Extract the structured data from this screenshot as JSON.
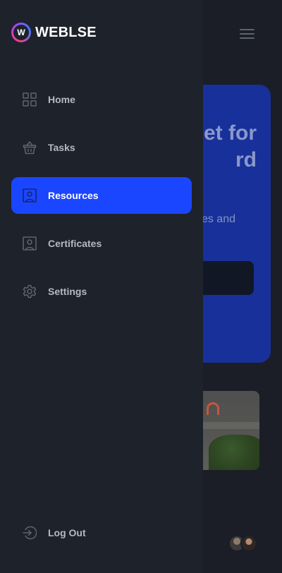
{
  "brand": {
    "logo_letter": "W",
    "name": "WEBLSE"
  },
  "background": {
    "hero_title": "et for\nrd",
    "hero_subtitle": "es and"
  },
  "nav": {
    "items": [
      {
        "label": "Home",
        "icon": "grid-icon",
        "active": false
      },
      {
        "label": "Tasks",
        "icon": "basket-icon",
        "active": false
      },
      {
        "label": "Resources",
        "icon": "portrait-icon",
        "active": true
      },
      {
        "label": "Certificates",
        "icon": "portrait-icon",
        "active": false
      },
      {
        "label": "Settings",
        "icon": "gear-icon",
        "active": false
      }
    ],
    "logout_label": "Log Out"
  },
  "colors": {
    "accent": "#1b46ff",
    "drawer_bg": "#1e222b",
    "nav_text": "#b4b9c3",
    "icon_stroke": "#5e6573"
  }
}
